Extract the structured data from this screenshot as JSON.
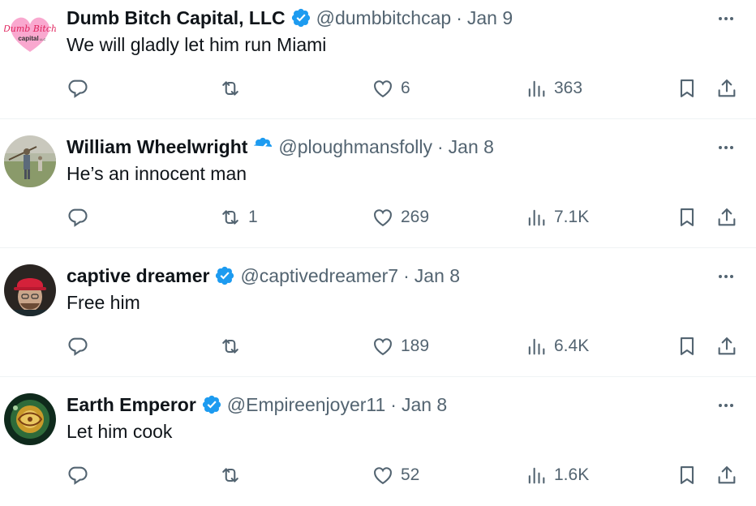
{
  "tweets": [
    {
      "display_name": "Dumb Bitch Capital, LLC",
      "handle": "@dumbbitchcap",
      "separator": "·",
      "date": "Jan 9",
      "text": "We will gladly let him run Miami",
      "avatar_text": "Dumb Bitch",
      "avatar_subtext": "capital",
      "avatar_subscript": "LLC",
      "replies": "",
      "retweets": "",
      "likes": "6",
      "views": "363"
    },
    {
      "display_name": "William Wheelwright",
      "handle": "@ploughmansfolly",
      "separator": "·",
      "date": "Jan 8",
      "text": "He’s an innocent man",
      "replies": "",
      "retweets": "1",
      "likes": "269",
      "views": "7.1K"
    },
    {
      "display_name": "captive dreamer",
      "handle": "@captivedreamer7",
      "separator": "·",
      "date": "Jan 8",
      "text": "Free him",
      "replies": "",
      "retweets": "",
      "likes": "189",
      "views": "6.4K"
    },
    {
      "display_name": "Earth Emperor",
      "handle": "@Empireenjoyer11",
      "separator": "·",
      "date": "Jan 8",
      "text": "Let him cook",
      "replies": "",
      "retweets": "",
      "likes": "52",
      "views": "1.6K"
    }
  ],
  "colors": {
    "text": "#0f1419",
    "secondary": "#536471",
    "verified": "#1d9bf0",
    "divider": "#eff3f4"
  },
  "icons": [
    "verified-badge-icon",
    "more-icon",
    "reply-icon",
    "retweet-icon",
    "like-icon",
    "views-icon",
    "bookmark-icon",
    "share-icon"
  ]
}
